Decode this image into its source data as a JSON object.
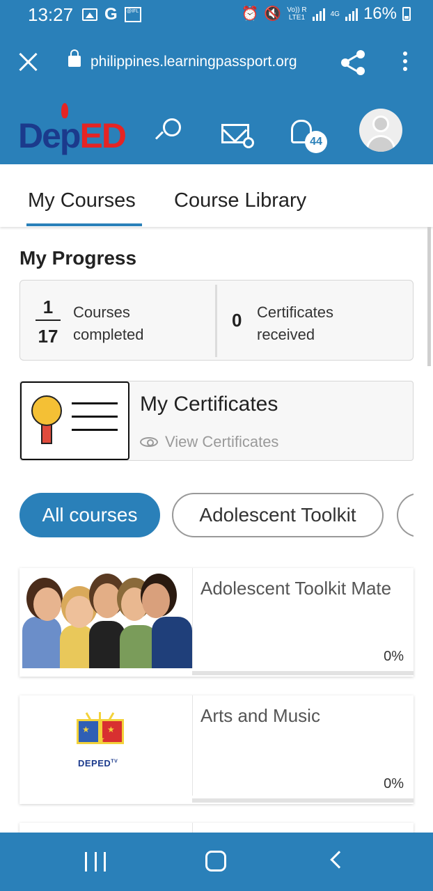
{
  "status_bar": {
    "time": "13:27",
    "battery": "16%",
    "network_top": "Vo)) R",
    "network_bottom": "LTE1",
    "network_type": "4G",
    "news_icon_label": "@IFL"
  },
  "browser": {
    "url": "philippines.learningpassport.org"
  },
  "header": {
    "logo_text_left": "Dep",
    "logo_text_right": "ED",
    "notification_count": "44"
  },
  "tabs": [
    {
      "label": "My Courses",
      "active": true
    },
    {
      "label": "Course Library",
      "active": false
    }
  ],
  "progress": {
    "title": "My Progress",
    "completed": "1",
    "total": "17",
    "courses_label": "Courses completed",
    "certificates_count": "0",
    "certificates_label": "Certificates received"
  },
  "certificates": {
    "title": "My Certificates",
    "link_label": "View Certificates"
  },
  "filters": [
    {
      "label": "All courses",
      "active": true
    },
    {
      "label": "Adolescent Toolkit",
      "active": false
    }
  ],
  "courses": [
    {
      "title": "Adolescent Toolkit Mate",
      "progress": "0%",
      "progress_value": 0
    },
    {
      "title": "Arts and Music",
      "progress": "0%",
      "progress_value": 0,
      "brand": "DEPED",
      "brand_sup": "TV"
    }
  ],
  "colors": {
    "primary": "#2a80b9",
    "logo_blue": "#1b3a8c",
    "logo_red": "#e52424"
  }
}
